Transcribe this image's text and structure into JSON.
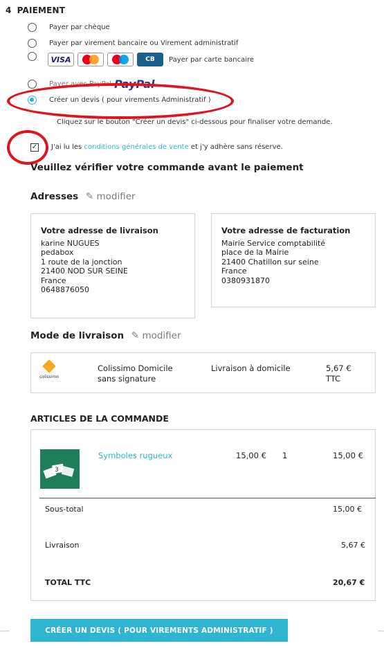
{
  "payment": {
    "step_number": "4",
    "step_title": "PAIEMENT",
    "options": [
      {
        "label": "Payer par chèque",
        "selected": false
      },
      {
        "label": "Payer par virement bancaire ou Virement administratif",
        "selected": false
      },
      {
        "label": "Payer par carte bancaire",
        "selected": false
      },
      {
        "label": "Payer avec PayPal",
        "selected": false
      },
      {
        "label": "Créer un devis ( pour virements Administratif )",
        "selected": true
      }
    ],
    "card_logos": {
      "visa": "VISA",
      "cb": "CB"
    },
    "paypal_logo": "PayPal",
    "info": "Cliquez sur le bouton \"Créer un devis\" ci-dessous pour finaliser votre demande."
  },
  "terms": {
    "checked": true,
    "before": "J'ai lu les ",
    "link": "conditions générales de vente",
    "after": " et j'y adhère sans réserve."
  },
  "verify_title": "Veuillez vérifier votre commande avant le paiement",
  "addresses": {
    "title": "Adresses",
    "edit": "modifier",
    "delivery": {
      "title": "Votre adresse de livraison",
      "lines": [
        "karine NUGUES",
        "pedabox",
        "1 route de la jonction",
        "21400 NOD SUR SEINE",
        "France",
        "0648876050"
      ]
    },
    "invoice": {
      "title": "Votre adresse de facturation",
      "lines": [
        "Mairie Service comptabilité",
        "place de la Mairie",
        "21400 Chatillon sur seine",
        "France",
        "0380931870"
      ]
    }
  },
  "shipping": {
    "title": "Mode de livraison",
    "edit": "modifier",
    "carrier_logo_text": "colissimo",
    "name_line1": "Colissimo Domicile",
    "name_line2": "sans signature",
    "delay": "Livraison à domicile",
    "price": "5,67 €",
    "price_tax": "TTC"
  },
  "articles": {
    "title": "ARTICLES DE LA COMMANDE",
    "items": [
      {
        "name": "Symboles rugueux",
        "unit_price": "15,00 €",
        "qty": "1",
        "total": "15,00 €"
      }
    ],
    "subtotal_label": "Sous-total",
    "subtotal": "15,00 €",
    "shipping_label": "Livraison",
    "shipping": "5,67 €",
    "total_label": "TOTAL TTC",
    "total": "20,67 €"
  },
  "submit_label": "CRÉER UN DEVIS ( POUR VIREMENTS ADMINISTRATIF )",
  "colors": {
    "accent": "#2fb5d2",
    "annotation": "#e0141e"
  }
}
